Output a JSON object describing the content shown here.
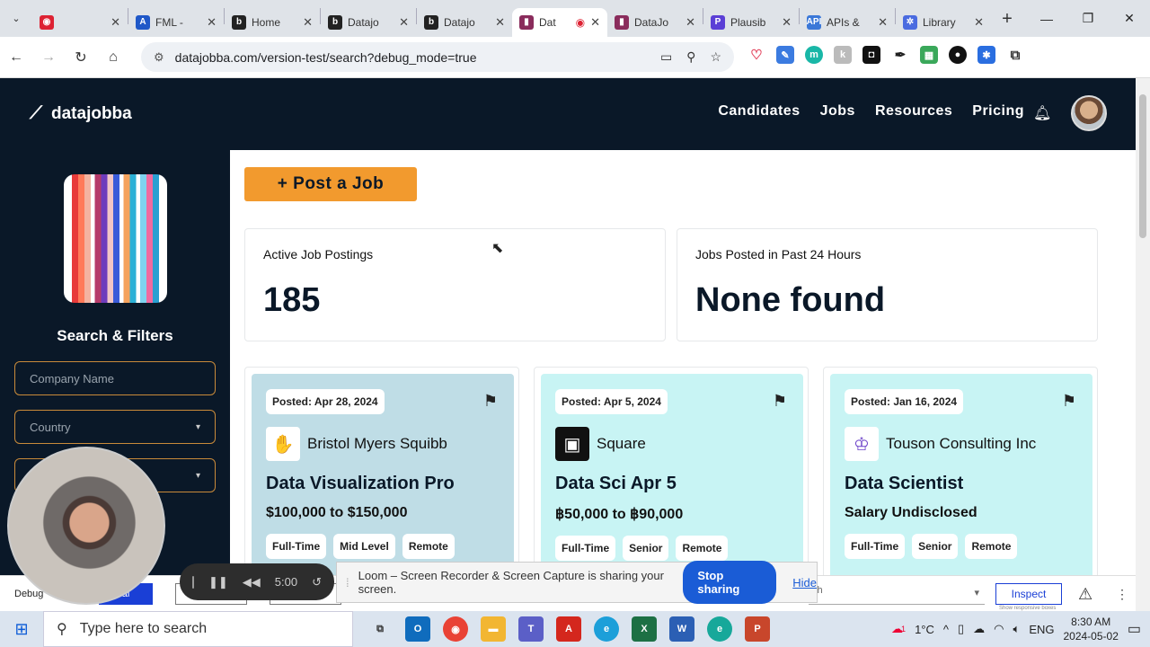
{
  "browser": {
    "tabs": [
      {
        "title": "",
        "favicon_color": "#d23",
        "glyph": "◉"
      },
      {
        "title": "FML - ",
        "favicon_color": "#1f58c8",
        "glyph": "A"
      },
      {
        "title": "Home",
        "favicon_color": "#222",
        "glyph": "b"
      },
      {
        "title": "Datajo",
        "favicon_color": "#222",
        "glyph": "b"
      },
      {
        "title": "Datajo",
        "favicon_color": "#222",
        "glyph": "b"
      },
      {
        "title": "Dat",
        "favicon_color": "#8a2c5c",
        "glyph": "▮",
        "active": true
      },
      {
        "title": "DataJo",
        "favicon_color": "#8a2c5c",
        "glyph": "▮"
      },
      {
        "title": "Plausib",
        "favicon_color": "#5b3fd6",
        "glyph": "P"
      },
      {
        "title": "APIs &",
        "favicon_color": "#3b78d8",
        "glyph": "API"
      },
      {
        "title": "Library",
        "favicon_color": "#4a6be0",
        "glyph": "✲"
      }
    ],
    "url": "datajobba.com/version-test/search?debug_mode=true"
  },
  "header": {
    "brand": "datajobba",
    "nav": [
      "Candidates",
      "Jobs",
      "Resources",
      "Pricing"
    ]
  },
  "sidebar": {
    "title": "Search & Filters",
    "company_placeholder": "Company Name",
    "country_label": "Country"
  },
  "main": {
    "post_button": "+ Post a Job",
    "stats": [
      {
        "label": "Active Job Postings",
        "value": "185"
      },
      {
        "label": "Jobs Posted in Past 24 Hours",
        "value": "None found"
      }
    ],
    "jobs": [
      {
        "posted": "Posted: Apr 28, 2024",
        "company": "Bristol Myers Squibb",
        "title": "Data Visualization Pro",
        "salary": "$100,000 to $150,000",
        "tags": [
          "Full-Time",
          "Mid Level",
          "Remote"
        ],
        "bg": "#bfdde6",
        "logo_glyph": "✋",
        "logo_color": "#9b2a8a"
      },
      {
        "posted": "Posted: Apr 5, 2024",
        "company": "Square",
        "title": "Data Sci Apr 5",
        "salary": "฿50,000 to ฿90,000",
        "tags": [
          "Full-Time",
          "Senior",
          "Remote"
        ],
        "bg": "#c8f4f4",
        "logo_glyph": "▣",
        "logo_color": "#fff"
      },
      {
        "posted": "Posted: Jan 16, 2024",
        "company": "Touson Consulting Inc",
        "title": "Data Scientist",
        "salary": "Salary Undisclosed",
        "tags": [
          "Full-Time",
          "Senior",
          "Remote"
        ],
        "bg": "#c8f4f4",
        "logo_glyph": "♔",
        "logo_color": "#6a3fc8"
      }
    ]
  },
  "debug": {
    "label": "Debug",
    "search_placeholder": "ch",
    "inspect": "Inspect",
    "hint": "Show responsive boxes"
  },
  "loom": {
    "timer": "5:00",
    "message": "Loom – Screen Recorder & Screen Capture is sharing your screen.",
    "stop": "Stop sharing",
    "hide": "Hide"
  },
  "taskbar": {
    "search_placeholder": "Type here to search",
    "temperature": "1°C",
    "language": "ENG",
    "time": "8:30 AM",
    "date": "2024-05-02",
    "weather_badge": "1"
  }
}
